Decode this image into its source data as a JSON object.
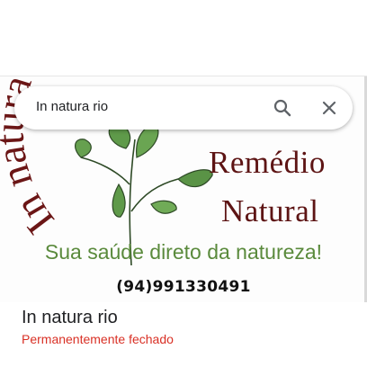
{
  "search": {
    "query": "In natura rio"
  },
  "photo": {
    "brand_line1": "Remédio",
    "brand_line2": "Natural",
    "arc_text": "In natura rio",
    "tagline": "Sua saúde direto da natureza!",
    "phone": "(94)991330491",
    "colors": {
      "brand": "#5d1414",
      "tagline": "#5a8a3c",
      "leaf": "#5f9a4a"
    }
  },
  "place": {
    "name": "In natura rio",
    "status": "Permanentemente fechado",
    "status_color": "#d93025"
  },
  "icons": {
    "search": "search-icon",
    "close": "close-icon"
  }
}
